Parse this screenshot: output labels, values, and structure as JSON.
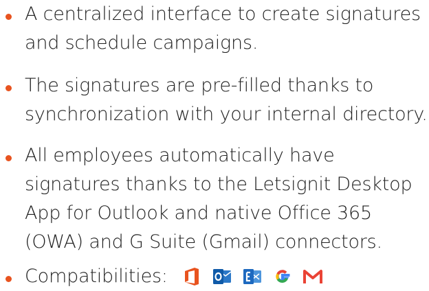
{
  "bullet_color": "#e8531f",
  "items": [
    {
      "text": "A centralized interface to create signatures and schedule campaigns."
    },
    {
      "text": "The signatures are pre-filled thanks to synchronization with your internal directory."
    },
    {
      "text": "All employees automatically have signatures thanks to the Letsignit Desktop App for Outlook and native Office 365 (OWA) and G Suite (Gmail) connectors."
    },
    {
      "text": "Compatibilities:"
    }
  ],
  "compat_icons": [
    "office-icon",
    "outlook-icon",
    "exchange-icon",
    "google-icon",
    "gmail-icon"
  ]
}
